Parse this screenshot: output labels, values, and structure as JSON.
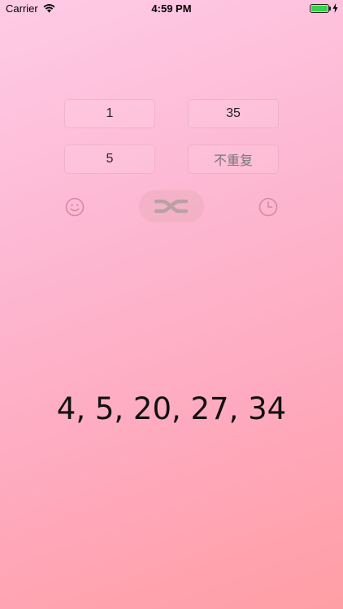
{
  "status_bar": {
    "carrier": "Carrier",
    "time": "4:59 PM",
    "battery_level": 1.0,
    "battery_color": "#3ad14b",
    "wifi_icon": "wifi-icon",
    "charging_icon": "bolt-icon"
  },
  "range": {
    "min": "1",
    "max": "35"
  },
  "options": {
    "count": "5",
    "mode": "不重复"
  },
  "actions": {
    "left_icon": "smiley-icon",
    "center_icon": "shuffle-icon",
    "right_icon": "clock-icon"
  },
  "result": {
    "text": "4, 5, 20, 27, 34"
  },
  "colors": {
    "background_top": "#fecbe6",
    "background_bottom": "#ff9ea4",
    "icon_color": "#d58aa0"
  }
}
